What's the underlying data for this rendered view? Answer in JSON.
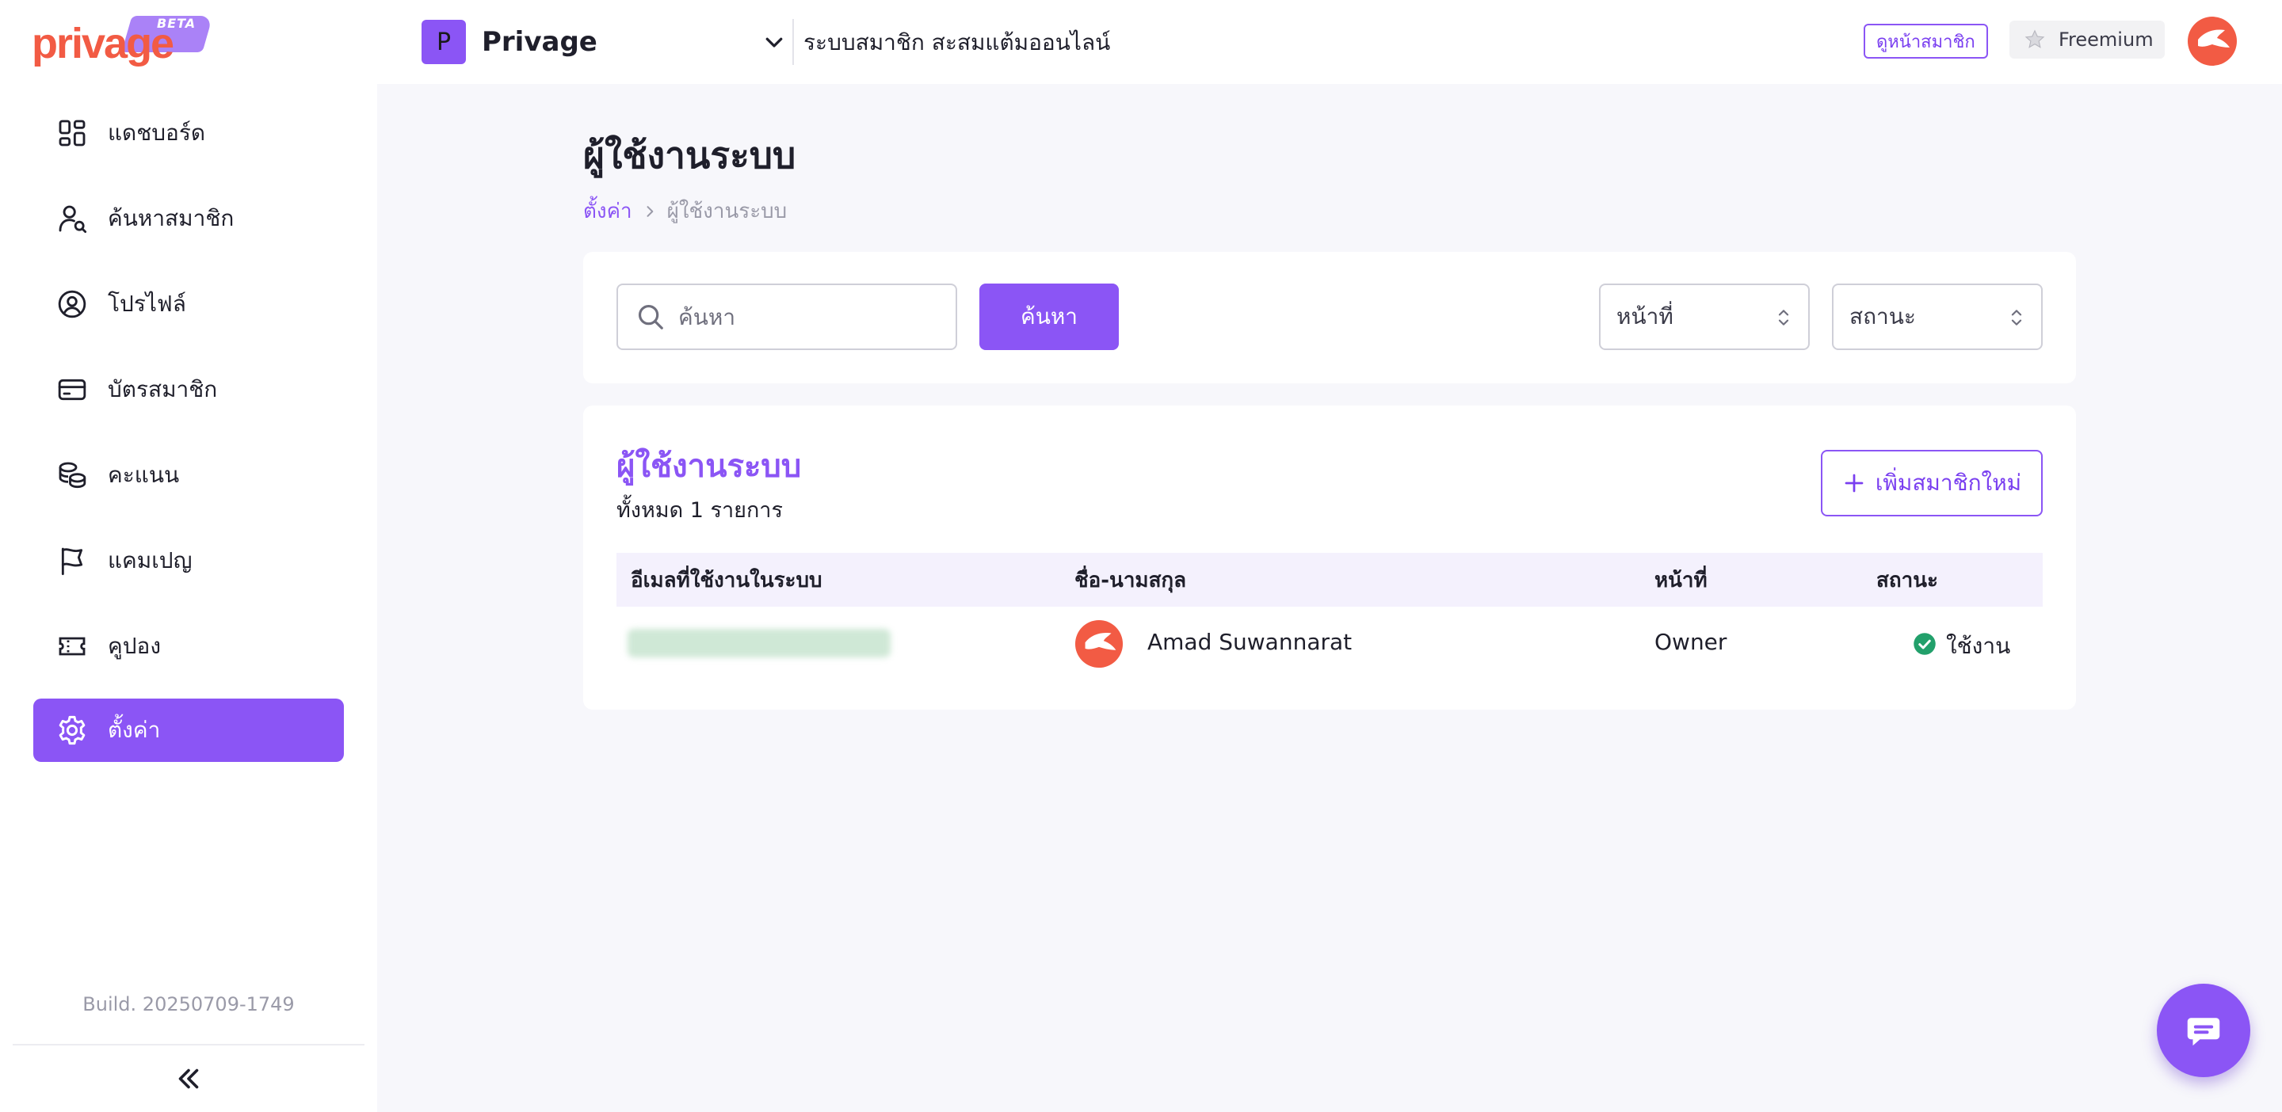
{
  "brand": {
    "logo_text": "privage",
    "logo_badge": "BETA",
    "accent": "#8b55f5",
    "logo_color": "#f25b44"
  },
  "topbar": {
    "project_initial": "P",
    "project_name": "Privage",
    "system_title": "ระบบสมาชิก สะสมแต้มออนไลน์",
    "view_member_label": "ดูหน้าสมาชิก",
    "plan_label": "Freemium"
  },
  "sidebar": {
    "items": [
      {
        "label": "แดชบอร์ด",
        "icon": "dashboard-icon"
      },
      {
        "label": "ค้นหาสมาชิก",
        "icon": "user-search-icon"
      },
      {
        "label": "โปรไฟล์",
        "icon": "profile-icon"
      },
      {
        "label": "บัตรสมาชิก",
        "icon": "card-icon"
      },
      {
        "label": "คะแนน",
        "icon": "coins-icon"
      },
      {
        "label": "แคมเปญ",
        "icon": "flag-icon"
      },
      {
        "label": "คูปอง",
        "icon": "ticket-icon"
      },
      {
        "label": "ตั้งค่า",
        "icon": "gear-icon",
        "active": true
      }
    ],
    "build": "Build. 20250709-1749"
  },
  "main": {
    "title": "ผู้ใช้งานระบบ",
    "breadcrumb": {
      "parent": "ตั้งค่า",
      "current": "ผู้ใช้งานระบบ"
    },
    "filters": {
      "search_placeholder": "ค้นหา",
      "search_button": "ค้นหา",
      "role_select": "หน้าที่",
      "status_select": "สถานะ"
    },
    "table": {
      "title": "ผู้ใช้งานระบบ",
      "count": "ทั้งหมด 1 รายการ",
      "add_button": "เพิ่มสมาชิกใหม่",
      "columns": [
        "อีเมลที่ใช้งานในระบบ",
        "ชื่อ-นามสกุล",
        "หน้าที่",
        "สถานะ"
      ],
      "rows": [
        {
          "name": "Amad Suwannarat",
          "role": "Owner",
          "status": "ใช้งาน",
          "status_color": "#22a06b"
        }
      ]
    }
  }
}
